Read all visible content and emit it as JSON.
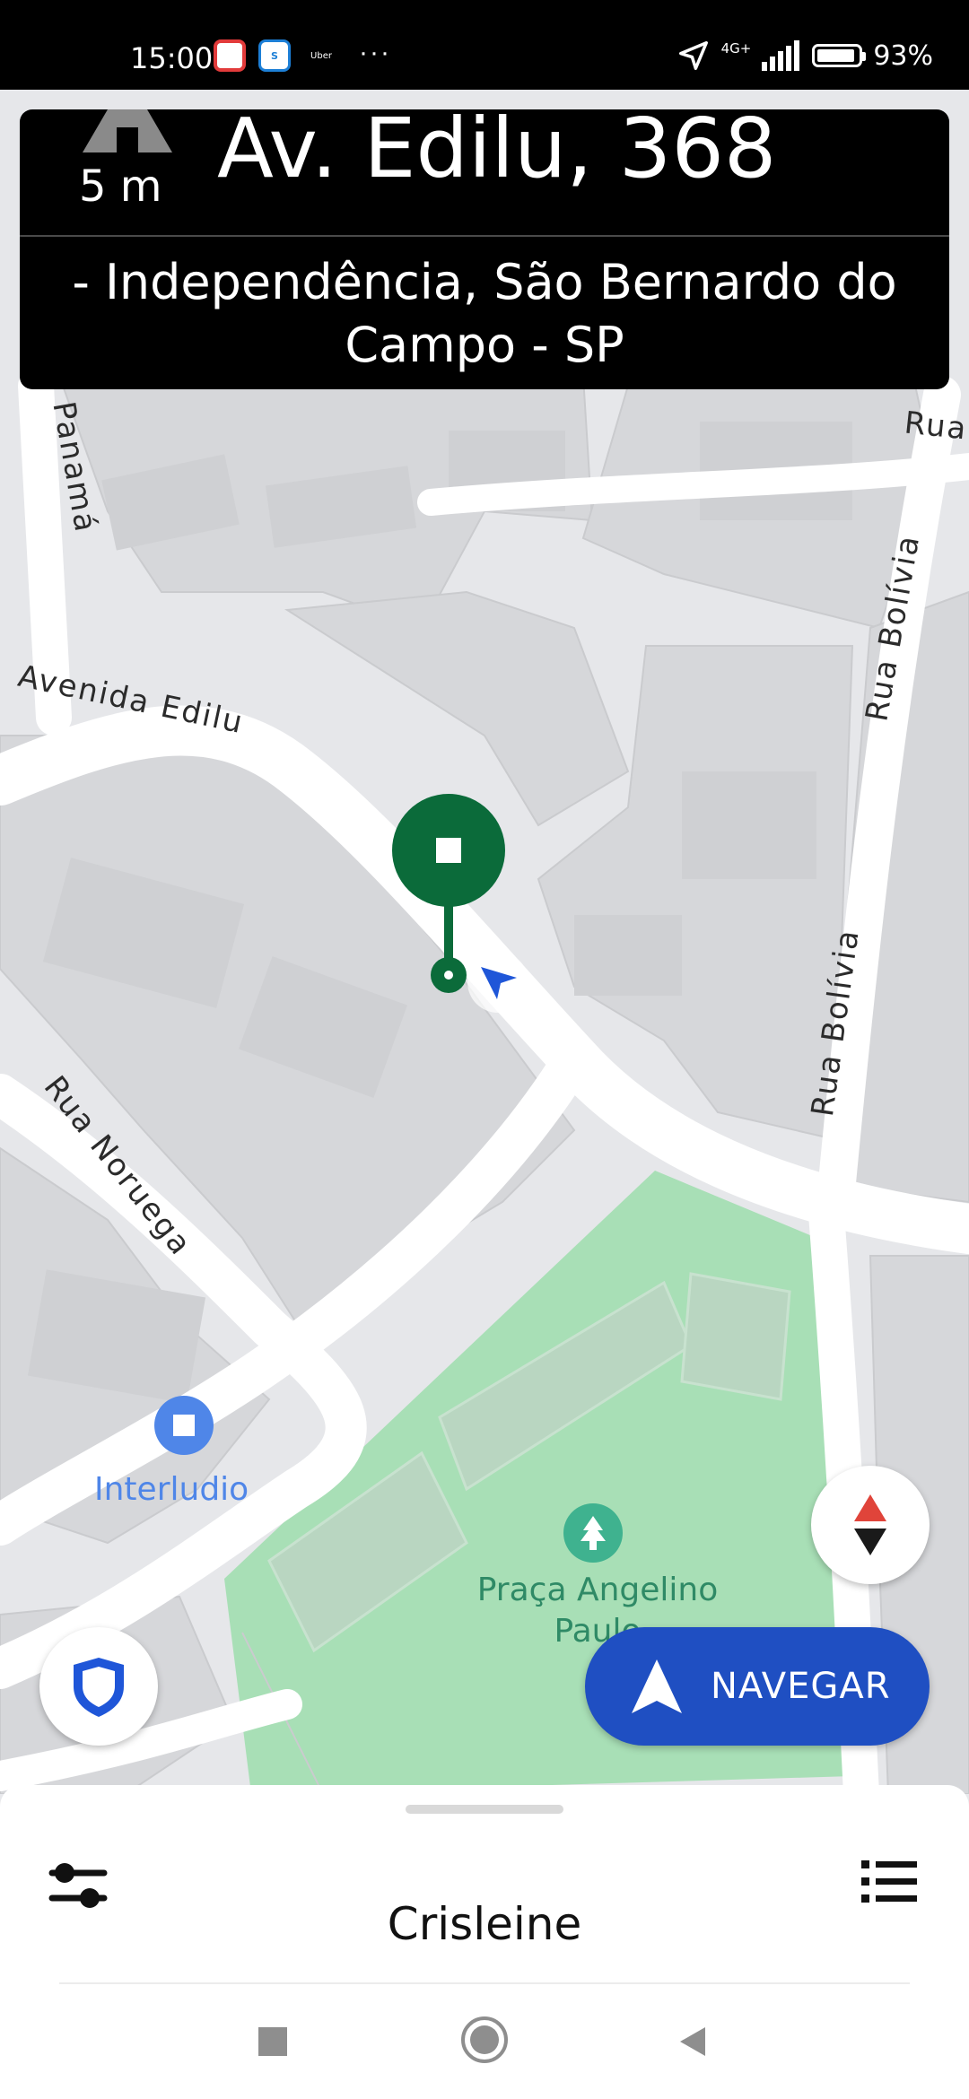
{
  "status_bar": {
    "time": "15:00",
    "app_red_label": "✉",
    "app_blue_label": "S",
    "app_uber_label": "Uber",
    "more": "···",
    "network": "4G+",
    "battery": "93%",
    "battery_level": 0.93
  },
  "banner": {
    "street": "Av. Edilu, 368",
    "distance": "5 m",
    "address": "- Independência, São Bernardo do Campo - SP"
  },
  "map": {
    "streets": {
      "panama": "Rua Panamá",
      "edilu": "Avenida Edilu",
      "bolivia_1": "Rua Bolívia",
      "bolivia_2": "Rua Bolívia",
      "noruega": "Rua Noruega",
      "rua": "Rua"
    },
    "pois": {
      "interludio": "Interludio",
      "praca": "Praça Angelino Paulo"
    },
    "colors": {
      "destination_pin": "#0b6b3a",
      "park": "#a8dfb6",
      "poi_blue": "#4f86e8",
      "park_icon": "#3fb28f"
    }
  },
  "controls": {
    "navigate_label": "NAVEGAR",
    "navigate_color": "#1f4fc2"
  },
  "bottom_sheet": {
    "rider_name": "Crisleine"
  },
  "icons": {
    "direction": "straight-arrow-icon",
    "compass": "compass-icon",
    "shield": "shield-icon",
    "navigate": "navigation-arrow-icon",
    "filter": "filter-sliders-icon",
    "list": "list-icon",
    "system": [
      "recents-icon",
      "home-icon",
      "back-icon"
    ]
  }
}
